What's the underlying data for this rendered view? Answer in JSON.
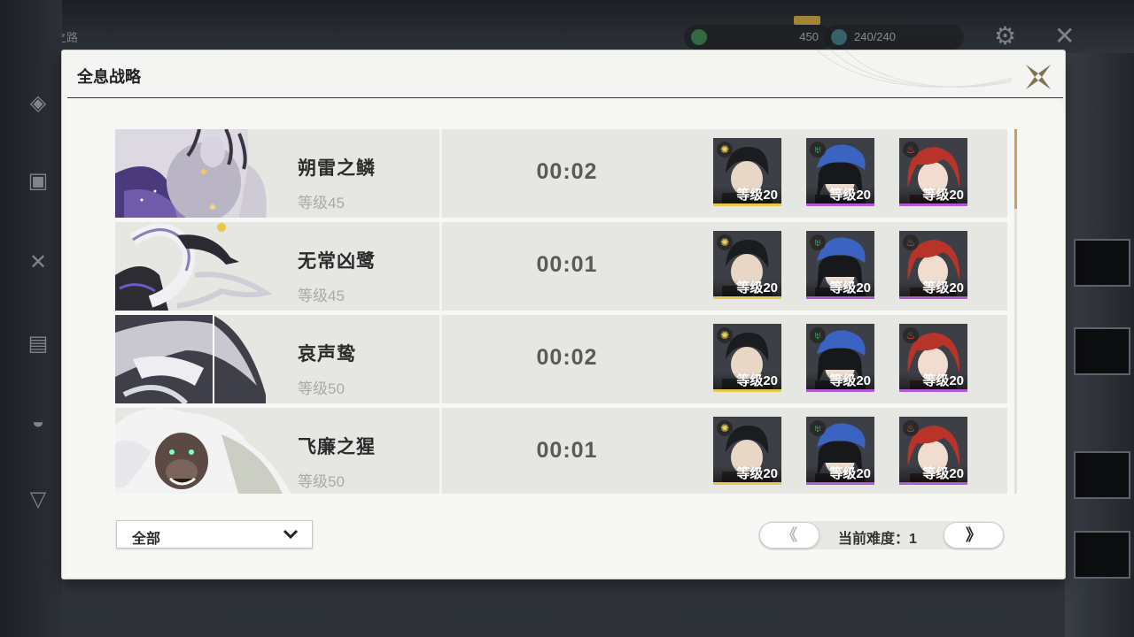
{
  "background": {
    "breadcrumb": "探索之路",
    "resources": [
      "450",
      "240/240"
    ]
  },
  "dialog": {
    "title": "全息战略",
    "close_label": "close"
  },
  "records": [
    {
      "boss_name": "朔雷之鳞",
      "boss_level": "等级45",
      "clear_time": "00:02",
      "team": [
        {
          "level": "等级20",
          "element": "spectro",
          "color": "#e8c84a"
        },
        {
          "level": "等级20",
          "element": "aero",
          "color": "#b05ad8"
        },
        {
          "level": "等级20",
          "element": "fusion",
          "color": "#b05ad8"
        }
      ]
    },
    {
      "boss_name": "无常凶鹭",
      "boss_level": "等级45",
      "clear_time": "00:01",
      "team": [
        {
          "level": "等级20",
          "element": "spectro",
          "color": "#e8c84a"
        },
        {
          "level": "等级20",
          "element": "aero",
          "color": "#b05ad8"
        },
        {
          "level": "等级20",
          "element": "fusion",
          "color": "#b05ad8"
        }
      ]
    },
    {
      "boss_name": "哀声鸷",
      "boss_level": "等级50",
      "clear_time": "00:02",
      "team": [
        {
          "level": "等级20",
          "element": "spectro",
          "color": "#e8c84a"
        },
        {
          "level": "等级20",
          "element": "aero",
          "color": "#b05ad8"
        },
        {
          "level": "等级20",
          "element": "fusion",
          "color": "#b05ad8"
        }
      ]
    },
    {
      "boss_name": "飞廉之猩",
      "boss_level": "等级50",
      "clear_time": "00:01",
      "team": [
        {
          "level": "等级20",
          "element": "spectro",
          "color": "#e8c84a"
        },
        {
          "level": "等级20",
          "element": "aero",
          "color": "#b05ad8"
        },
        {
          "level": "等级20",
          "element": "fusion",
          "color": "#b05ad8"
        }
      ]
    }
  ],
  "footer": {
    "filter_label": "全部",
    "difficulty_label": "当前难度：",
    "difficulty_value": "1",
    "prev_symbol": "《",
    "next_symbol": "》"
  },
  "colors": {
    "accent_gold": "#c9a15c",
    "five_star": "#e8c84a",
    "four_star": "#b05ad8"
  }
}
